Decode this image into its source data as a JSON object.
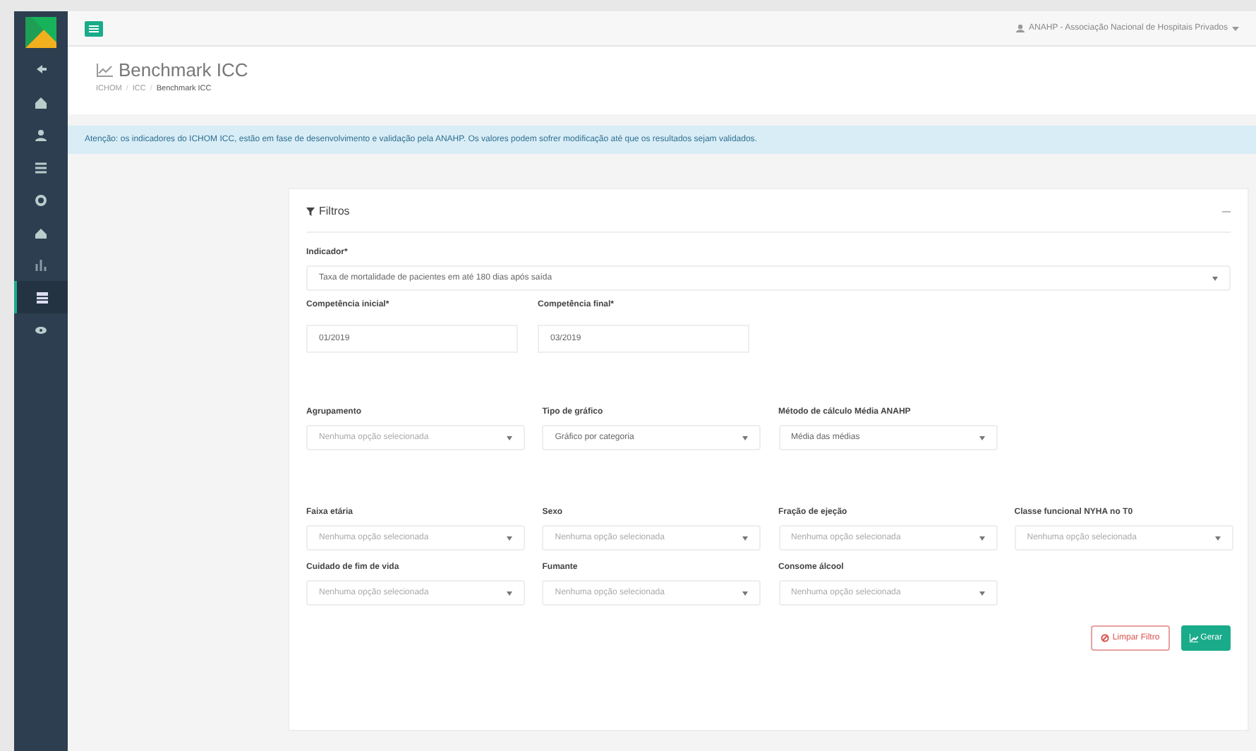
{
  "sidebar": {
    "items": [
      {
        "selected": false
      },
      {
        "selected": false
      },
      {
        "selected": false
      },
      {
        "selected": false
      },
      {
        "selected": false
      },
      {
        "selected": false
      },
      {
        "selected": false
      },
      {
        "selected": true
      },
      {
        "selected": false
      }
    ]
  },
  "topbar": {
    "user": "ANAHP - Associação Nacional de Hospitais Privados"
  },
  "page_title": "Benchmark ICC",
  "breadcrumb": {
    "separator": "/",
    "items": [
      "ICHOM",
      "ICC",
      "Benchmark ICC"
    ]
  },
  "alert": "Atenção: os indicadores do ICHOM ICC, estão em fase de desenvolvimento e validação pela ANAHP. Os valores podem sofrer modificação até que os resultados sejam validados.",
  "panel": {
    "title": "Filtros",
    "indicator": {
      "label": "Indicador*",
      "value": "Taxa de mortalidade de pacientes em até 180 dias após saída"
    },
    "dates": [
      {
        "label": "Competência inicial*",
        "value": "01/2019"
      },
      {
        "label": "Competência final*",
        "value": "03/2019"
      }
    ],
    "rows": [
      [
        {
          "label": "Agrupamento",
          "placeholder": "Nenhuma opção selecionada"
        },
        {
          "label": "Tipo de gráfico",
          "value": "Gráfico por categoria"
        },
        {
          "label": "Método de cálculo Média ANAHP",
          "value": "Média das médias"
        }
      ],
      [
        {
          "label": "Faixa etária",
          "placeholder": "Nenhuma opção selecionada"
        },
        {
          "label": "Sexo",
          "placeholder": "Nenhuma opção selecionada"
        },
        {
          "label": "Fração de ejeção",
          "placeholder": "Nenhuma opção selecionada"
        },
        {
          "label": "Classe funcional NYHA no T0",
          "placeholder": "Nenhuma opção selecionada"
        }
      ],
      [
        {
          "label": "Cuidado de fim de vida",
          "placeholder": "Nenhuma opção selecionada"
        },
        {
          "label": "Fumante",
          "placeholder": "Nenhuma opção selecionada"
        },
        {
          "label": "Consome álcool",
          "placeholder": "Nenhuma opção selecionada"
        }
      ]
    ],
    "buttons": [
      {
        "kind": "clear",
        "label": "Limpar Filtro"
      },
      {
        "kind": "generate",
        "label": "Gerar"
      }
    ]
  }
}
